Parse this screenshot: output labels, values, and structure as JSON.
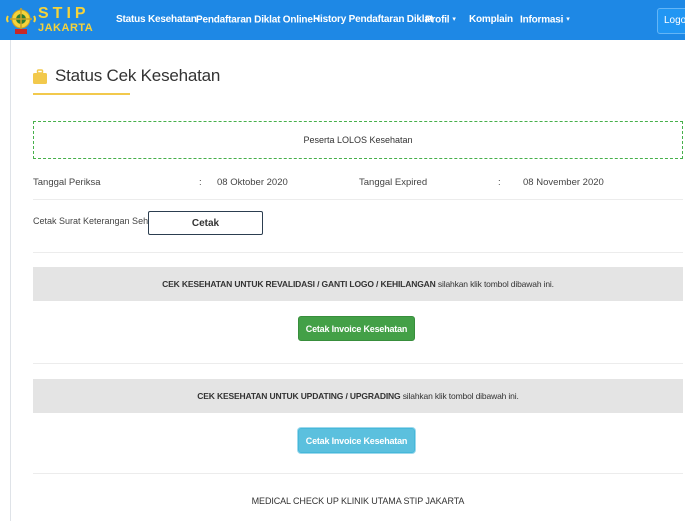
{
  "navbar": {
    "brand_top": "STIP",
    "brand_bottom": "JAKARTA",
    "items": [
      {
        "label": "Status Kesehatan"
      },
      {
        "label": "Pendaftaran Diklat Online",
        "caret": "▾"
      },
      {
        "label": "History Pendaftaran Diklat"
      },
      {
        "label": "Profil",
        "caret": "▾"
      },
      {
        "label": "Komplain"
      },
      {
        "label": "Informasi",
        "caret": "▾"
      }
    ],
    "logout_label": "Logout",
    "bg_color": "#1e88e5"
  },
  "page": {
    "title": "Status Cek Kesehatan",
    "status_message": "Peserta LOLOS Kesehatan",
    "info": {
      "check_label": "Tanggal Periksa",
      "check_sep": ":",
      "check_value": "08 Oktober 2020",
      "expired_label": "Tanggal Expired",
      "expired_sep": ":",
      "expired_value": "08 November 2020"
    },
    "cetak": {
      "label": "Cetak Surat Keterangan Sehat :",
      "button": "Cetak"
    },
    "section1": {
      "bold_text": "CEK KESEHATAN UNTUK REVALIDASI / GANTI LOGO / KEHILANGAN",
      "normal_text": " silahkan klik tombol dibawah ini.",
      "button": "Cetak Invoice Kesehatan",
      "button_color": "#43a047"
    },
    "section2": {
      "bold_text": "CEK KESEHATAN UNTUK UPDATING / UPGRADING",
      "normal_text": " silahkan klik tombol dibawah ini.",
      "button": "Cetak Invoice Kesehatan",
      "button_color": "#5bc0de"
    },
    "footer": "MEDICAL CHECK UP KLINIK UTAMA STIP JAKARTA"
  }
}
